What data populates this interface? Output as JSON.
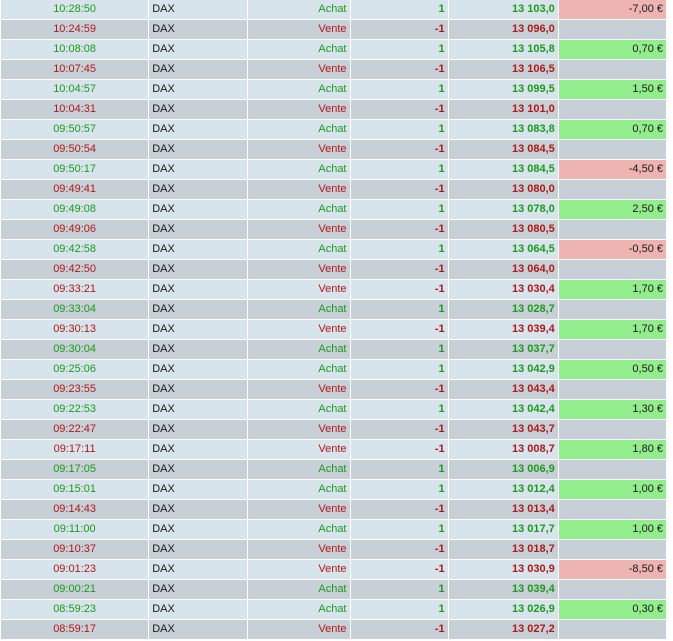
{
  "trades": [
    {
      "time": "10:28:50",
      "symbol": "DAX",
      "side": "Achat",
      "qty": "1",
      "price": "13 103,0",
      "pnl": "-7,00 €"
    },
    {
      "time": "10:24:59",
      "symbol": "DAX",
      "side": "Vente",
      "qty": "-1",
      "price": "13 096,0",
      "pnl": ""
    },
    {
      "time": "10:08:08",
      "symbol": "DAX",
      "side": "Achat",
      "qty": "1",
      "price": "13 105,8",
      "pnl": "0,70 €"
    },
    {
      "time": "10:07:45",
      "symbol": "DAX",
      "side": "Vente",
      "qty": "-1",
      "price": "13 106,5",
      "pnl": ""
    },
    {
      "time": "10:04:57",
      "symbol": "DAX",
      "side": "Achat",
      "qty": "1",
      "price": "13 099,5",
      "pnl": "1,50 €"
    },
    {
      "time": "10:04:31",
      "symbol": "DAX",
      "side": "Vente",
      "qty": "-1",
      "price": "13 101,0",
      "pnl": ""
    },
    {
      "time": "09:50:57",
      "symbol": "DAX",
      "side": "Achat",
      "qty": "1",
      "price": "13 083,8",
      "pnl": "0,70 €"
    },
    {
      "time": "09:50:54",
      "symbol": "DAX",
      "side": "Vente",
      "qty": "-1",
      "price": "13 084,5",
      "pnl": ""
    },
    {
      "time": "09:50:17",
      "symbol": "DAX",
      "side": "Achat",
      "qty": "1",
      "price": "13 084,5",
      "pnl": "-4,50 €"
    },
    {
      "time": "09:49:41",
      "symbol": "DAX",
      "side": "Vente",
      "qty": "-1",
      "price": "13 080,0",
      "pnl": ""
    },
    {
      "time": "09:49:08",
      "symbol": "DAX",
      "side": "Achat",
      "qty": "1",
      "price": "13 078,0",
      "pnl": "2,50 €"
    },
    {
      "time": "09:49:06",
      "symbol": "DAX",
      "side": "Vente",
      "qty": "-1",
      "price": "13 080,5",
      "pnl": ""
    },
    {
      "time": "09:42:58",
      "symbol": "DAX",
      "side": "Achat",
      "qty": "1",
      "price": "13 064,5",
      "pnl": "-0,50 €"
    },
    {
      "time": "09:42:50",
      "symbol": "DAX",
      "side": "Vente",
      "qty": "-1",
      "price": "13 064,0",
      "pnl": ""
    },
    {
      "time": "09:33:21",
      "symbol": "DAX",
      "side": "Vente",
      "qty": "-1",
      "price": "13 030,4",
      "pnl": "1,70 €"
    },
    {
      "time": "09:33:04",
      "symbol": "DAX",
      "side": "Achat",
      "qty": "1",
      "price": "13 028,7",
      "pnl": ""
    },
    {
      "time": "09:30:13",
      "symbol": "DAX",
      "side": "Vente",
      "qty": "-1",
      "price": "13 039,4",
      "pnl": "1,70 €"
    },
    {
      "time": "09:30:04",
      "symbol": "DAX",
      "side": "Achat",
      "qty": "1",
      "price": "13 037,7",
      "pnl": ""
    },
    {
      "time": "09:25:06",
      "symbol": "DAX",
      "side": "Achat",
      "qty": "1",
      "price": "13 042,9",
      "pnl": "0,50 €"
    },
    {
      "time": "09:23:55",
      "symbol": "DAX",
      "side": "Vente",
      "qty": "-1",
      "price": "13 043,4",
      "pnl": ""
    },
    {
      "time": "09:22:53",
      "symbol": "DAX",
      "side": "Achat",
      "qty": "1",
      "price": "13 042,4",
      "pnl": "1,30 €"
    },
    {
      "time": "09:22:47",
      "symbol": "DAX",
      "side": "Vente",
      "qty": "-1",
      "price": "13 043,7",
      "pnl": ""
    },
    {
      "time": "09:17:11",
      "symbol": "DAX",
      "side": "Vente",
      "qty": "-1",
      "price": "13 008,7",
      "pnl": "1,80 €"
    },
    {
      "time": "09:17:05",
      "symbol": "DAX",
      "side": "Achat",
      "qty": "1",
      "price": "13 006,9",
      "pnl": ""
    },
    {
      "time": "09:15:01",
      "symbol": "DAX",
      "side": "Achat",
      "qty": "1",
      "price": "13 012,4",
      "pnl": "1,00 €"
    },
    {
      "time": "09:14:43",
      "symbol": "DAX",
      "side": "Vente",
      "qty": "-1",
      "price": "13 013,4",
      "pnl": ""
    },
    {
      "time": "09:11:00",
      "symbol": "DAX",
      "side": "Achat",
      "qty": "1",
      "price": "13 017,7",
      "pnl": "1,00 €"
    },
    {
      "time": "09:10:37",
      "symbol": "DAX",
      "side": "Vente",
      "qty": "-1",
      "price": "13 018,7",
      "pnl": ""
    },
    {
      "time": "09:01:23",
      "symbol": "DAX",
      "side": "Vente",
      "qty": "-1",
      "price": "13 030,9",
      "pnl": "-8,50 €"
    },
    {
      "time": "09:00:21",
      "symbol": "DAX",
      "side": "Achat",
      "qty": "1",
      "price": "13 039,4",
      "pnl": ""
    },
    {
      "time": "08:59:23",
      "symbol": "DAX",
      "side": "Achat",
      "qty": "1",
      "price": "13 026,9",
      "pnl": "0,30 €"
    },
    {
      "time": "08:59:17",
      "symbol": "DAX",
      "side": "Vente",
      "qty": "-1",
      "price": "13 027,2",
      "pnl": ""
    }
  ],
  "colors": {
    "buy_text": "#1c9a1c",
    "sell_text": "#b01818",
    "row_light": "#d8e4ec",
    "row_dark": "#c7cfd7",
    "pnl_positive_bg": "#92ee8c",
    "pnl_negative_bg": "#edb4b2"
  }
}
